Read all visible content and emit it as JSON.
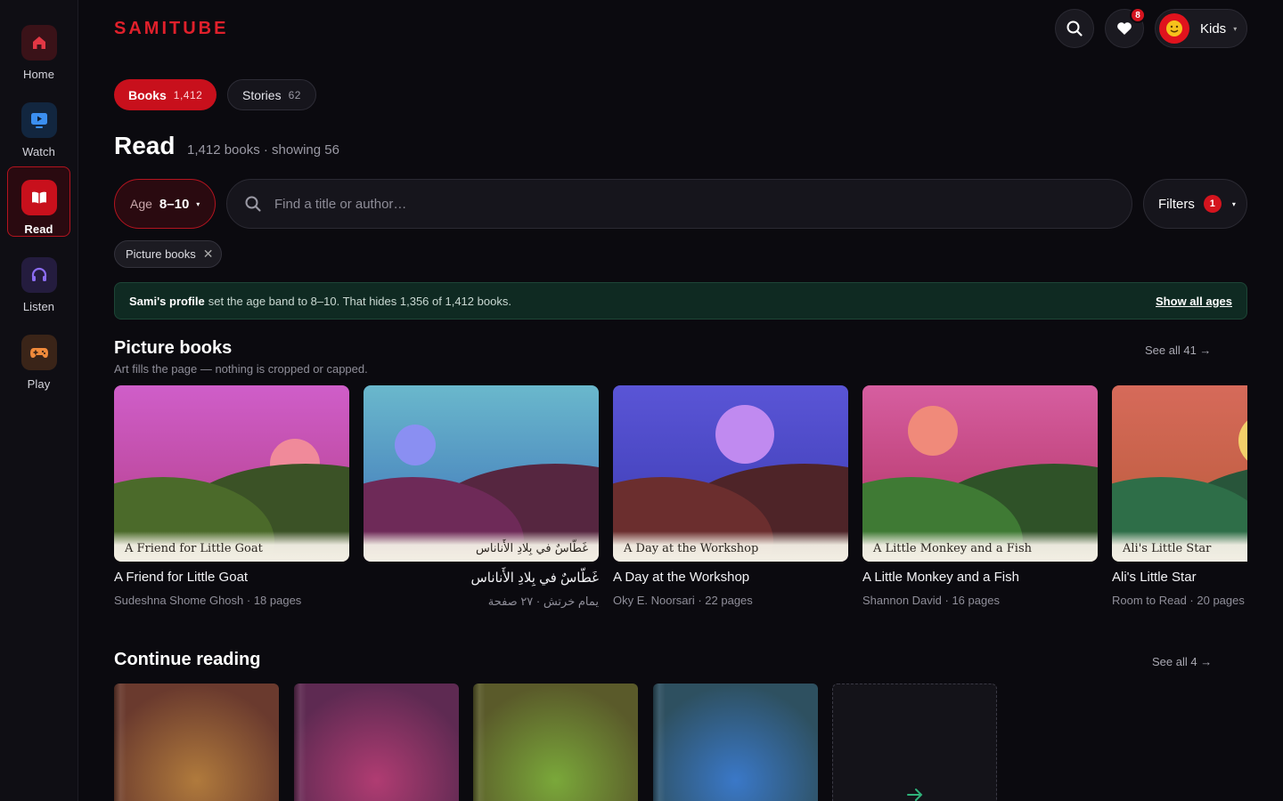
{
  "app": {
    "logo": "SAMITUBE"
  },
  "sidebar": {
    "items": [
      {
        "label": "Home",
        "icon": "home-icon",
        "color": "#e23744"
      },
      {
        "label": "Watch",
        "icon": "play-screen-icon",
        "color": "#3b8ff0"
      },
      {
        "label": "Read",
        "icon": "book-icon",
        "color": "#ffffff",
        "active": true
      },
      {
        "label": "Listen",
        "icon": "headphones-icon",
        "color": "#8b6cf0"
      },
      {
        "label": "Play",
        "icon": "gamepad-icon",
        "color": "#f08a3b"
      }
    ]
  },
  "header": {
    "favorites_count": "8",
    "profile_name": "Kids",
    "profile_caret": "▾"
  },
  "tabs": [
    {
      "label": "Books",
      "count": "1,412",
      "active": true
    },
    {
      "label": "Stories",
      "count": "62",
      "active": false
    }
  ],
  "page": {
    "title": "Read",
    "subtitle": "1,412 books · showing 56"
  },
  "controls": {
    "age_label": "Age",
    "age_value": "8–10",
    "caret": "▾",
    "search_placeholder": "Find a title or author…",
    "filters_label": "Filters",
    "filters_count": "1"
  },
  "chips": [
    {
      "label": "Picture books"
    }
  ],
  "notice": {
    "bold": "Sami's profile",
    "text": "set the age band to 8–10. That hides 1,356 of 1,412 books.",
    "action": "Show all ages"
  },
  "sections": {
    "picture_books": {
      "title": "Picture books",
      "subtitle": "Art fills the page — nothing is cropped or capped.",
      "see_all": "See all 41 →",
      "books": [
        {
          "cover_text": "A Friend for Little Goat",
          "title": "A Friend for Little Goat",
          "meta": "Sudeshna Shome Ghosh · 18 pages",
          "rtl": false,
          "sky_top": "#cf5ec9",
          "sky_bottom": "#b33c84",
          "sun": "#f08a9a",
          "hill_front": "#4b6a2a",
          "hill_back": "#3b5226"
        },
        {
          "cover_text": "غَطّاسٌ في بِلادِ الأَناناس",
          "title": "غَطّاسٌ في بِلادِ الأَناناس",
          "meta": "يمام خرتش · ٢٧ صفحة",
          "rtl": true,
          "sky_top": "#6ab8cc",
          "sky_bottom": "#3b6eb8",
          "sun": "#8a8ff2",
          "hill_front": "#6e2a58",
          "hill_back": "#562640"
        },
        {
          "cover_text": "A Day at the Workshop",
          "title": "A Day at the Workshop",
          "meta": "Oky E. Noorsari · 22 pages",
          "rtl": false,
          "sky_top": "#5a55d6",
          "sky_bottom": "#3a3ab0",
          "sun": "#c08af0",
          "hill_front": "#6b2e2e",
          "hill_back": "#4e2428"
        },
        {
          "cover_text": "A Little Monkey and a Fish",
          "title": "A Little Monkey and a Fish",
          "meta": "Shannon David · 16 pages",
          "rtl": false,
          "sky_top": "#d65ea0",
          "sky_bottom": "#b03060",
          "sun": "#f08a7a",
          "hill_front": "#3f7a34",
          "hill_back": "#2f5228"
        },
        {
          "cover_text": "Ali's Little Star",
          "title": "Ali's Little Star",
          "meta": "Room to Read · 20 pages",
          "rtl": false,
          "sky_top": "#d66a5a",
          "sky_bottom": "#b85a38",
          "sun": "#f4d06a",
          "hill_front": "#2e6e48",
          "hill_back": "#28553a"
        }
      ]
    },
    "continue_reading": {
      "title": "Continue reading",
      "see_all": "See all 4 →",
      "items": [
        {
          "color_a": "#b07a3c",
          "color_b": "#6a3a2e"
        },
        {
          "color_a": "#b03c72",
          "color_b": "#5e2a52"
        },
        {
          "color_a": "#7aa83a",
          "color_b": "#5a5a2a"
        },
        {
          "color_a": "#3a78c8",
          "color_b": "#2e5060"
        }
      ],
      "more_icon": "arrow-right-icon"
    }
  },
  "colors": {
    "accent": "#d4141e",
    "background": "#0b0a0f",
    "notice_bg": "#0f2a22"
  }
}
